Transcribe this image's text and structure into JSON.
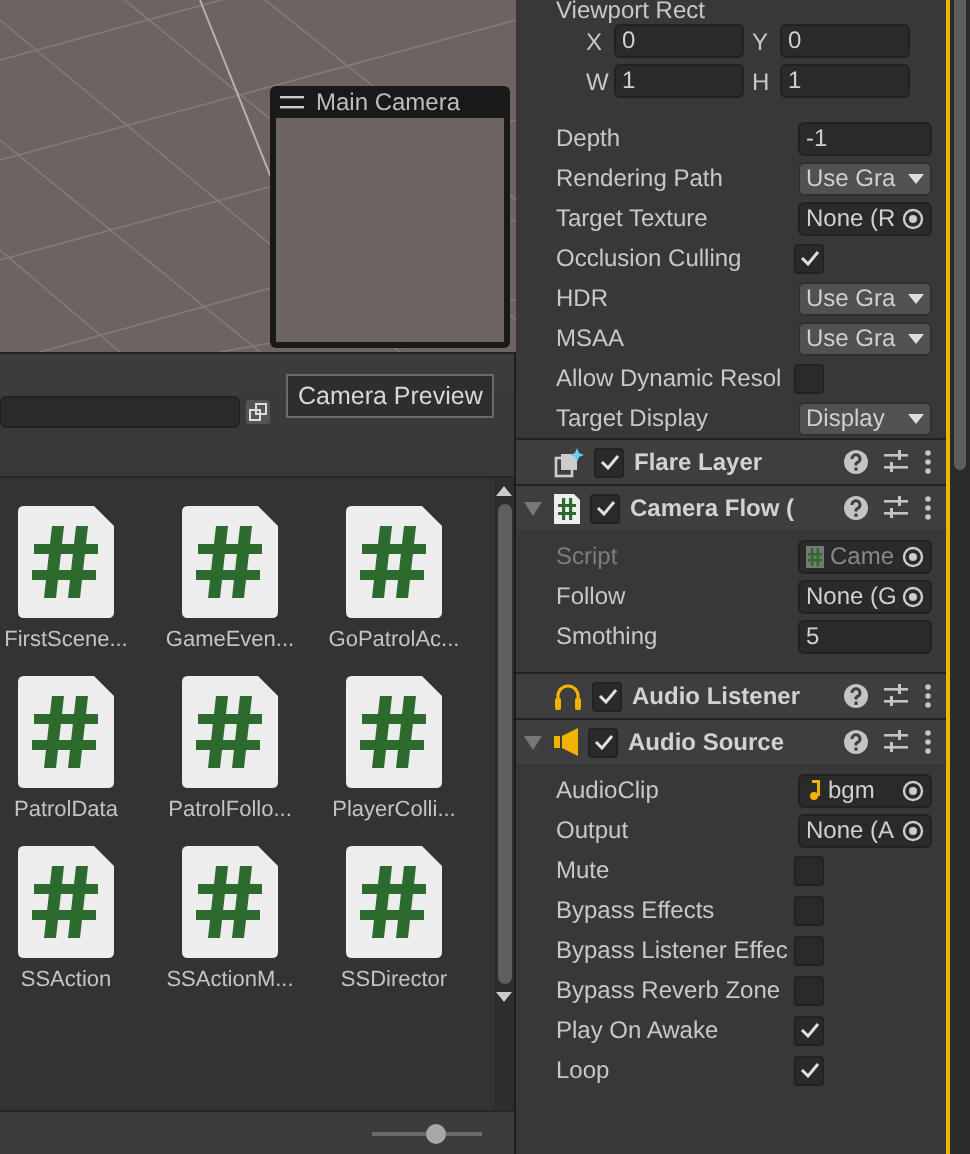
{
  "scene_view": {
    "camera_preview": {
      "title": "Main Camera"
    },
    "tooltip": "Camera Preview"
  },
  "project": {
    "assets": [
      {
        "name": "FirstScene..."
      },
      {
        "name": "GameEven..."
      },
      {
        "name": "GoPatrolAc..."
      },
      {
        "name": "PatrolData"
      },
      {
        "name": "PatrolFollo..."
      },
      {
        "name": "PlayerColli..."
      },
      {
        "name": "SSAction"
      },
      {
        "name": "SSActionM..."
      },
      {
        "name": "SSDirector"
      }
    ],
    "zoom_slider": {
      "level": 0.58
    }
  },
  "inspector": {
    "viewport_rect": {
      "label": "Viewport Rect",
      "fields": [
        {
          "label": "X",
          "value": "0"
        },
        {
          "label": "Y",
          "value": "0"
        },
        {
          "label": "W",
          "value": "1"
        },
        {
          "label": "H",
          "value": "1"
        }
      ]
    },
    "camera_rows": [
      {
        "kind": "number",
        "label": "Depth",
        "value": "-1"
      },
      {
        "kind": "dropdown",
        "label": "Rendering Path",
        "value": "Use Gra"
      },
      {
        "kind": "object",
        "label": "Target Texture",
        "value": "None (R"
      },
      {
        "kind": "checkbox",
        "label": "Occlusion Culling",
        "checked": true
      },
      {
        "kind": "dropdown",
        "label": "HDR",
        "value": "Use Gra"
      },
      {
        "kind": "dropdown",
        "label": "MSAA",
        "value": "Use Gra"
      },
      {
        "kind": "checkbox",
        "label": "Allow Dynamic Resol",
        "checked": false
      },
      {
        "kind": "dropdown",
        "label": "Target Display",
        "value": "Display"
      }
    ],
    "components": [
      {
        "kind": "plain",
        "title": "Flare Layer",
        "enabled": true
      },
      {
        "kind": "foldable",
        "title": "Camera Flow (",
        "enabled": true,
        "expanded": true,
        "fields": [
          {
            "kind": "script",
            "label": "Script",
            "value": "Came",
            "disabled": true
          },
          {
            "kind": "object",
            "label": "Follow",
            "value": "None (G",
            "disabled": false
          },
          {
            "kind": "number",
            "label": "Smothing",
            "value": "5",
            "disabled": false
          }
        ]
      },
      {
        "kind": "plain",
        "title": "Audio Listener",
        "enabled": true
      },
      {
        "kind": "foldable",
        "title": "Audio Source",
        "enabled": true,
        "expanded": true,
        "fields": [
          {
            "kind": "clip",
            "label": "AudioClip",
            "value": "bgm"
          },
          {
            "kind": "object",
            "label": "Output",
            "value": "None (A"
          },
          {
            "kind": "checkbox",
            "label": "Mute",
            "checked": false
          },
          {
            "kind": "checkbox",
            "label": "Bypass Effects",
            "checked": false
          },
          {
            "kind": "checkbox",
            "label": "Bypass Listener Effec",
            "checked": false
          },
          {
            "kind": "checkbox",
            "label": "Bypass Reverb Zone",
            "checked": false
          },
          {
            "kind": "checkbox",
            "label": "Play On Awake",
            "checked": true
          },
          {
            "kind": "checkbox",
            "label": "Loop",
            "checked": true
          }
        ]
      }
    ]
  }
}
